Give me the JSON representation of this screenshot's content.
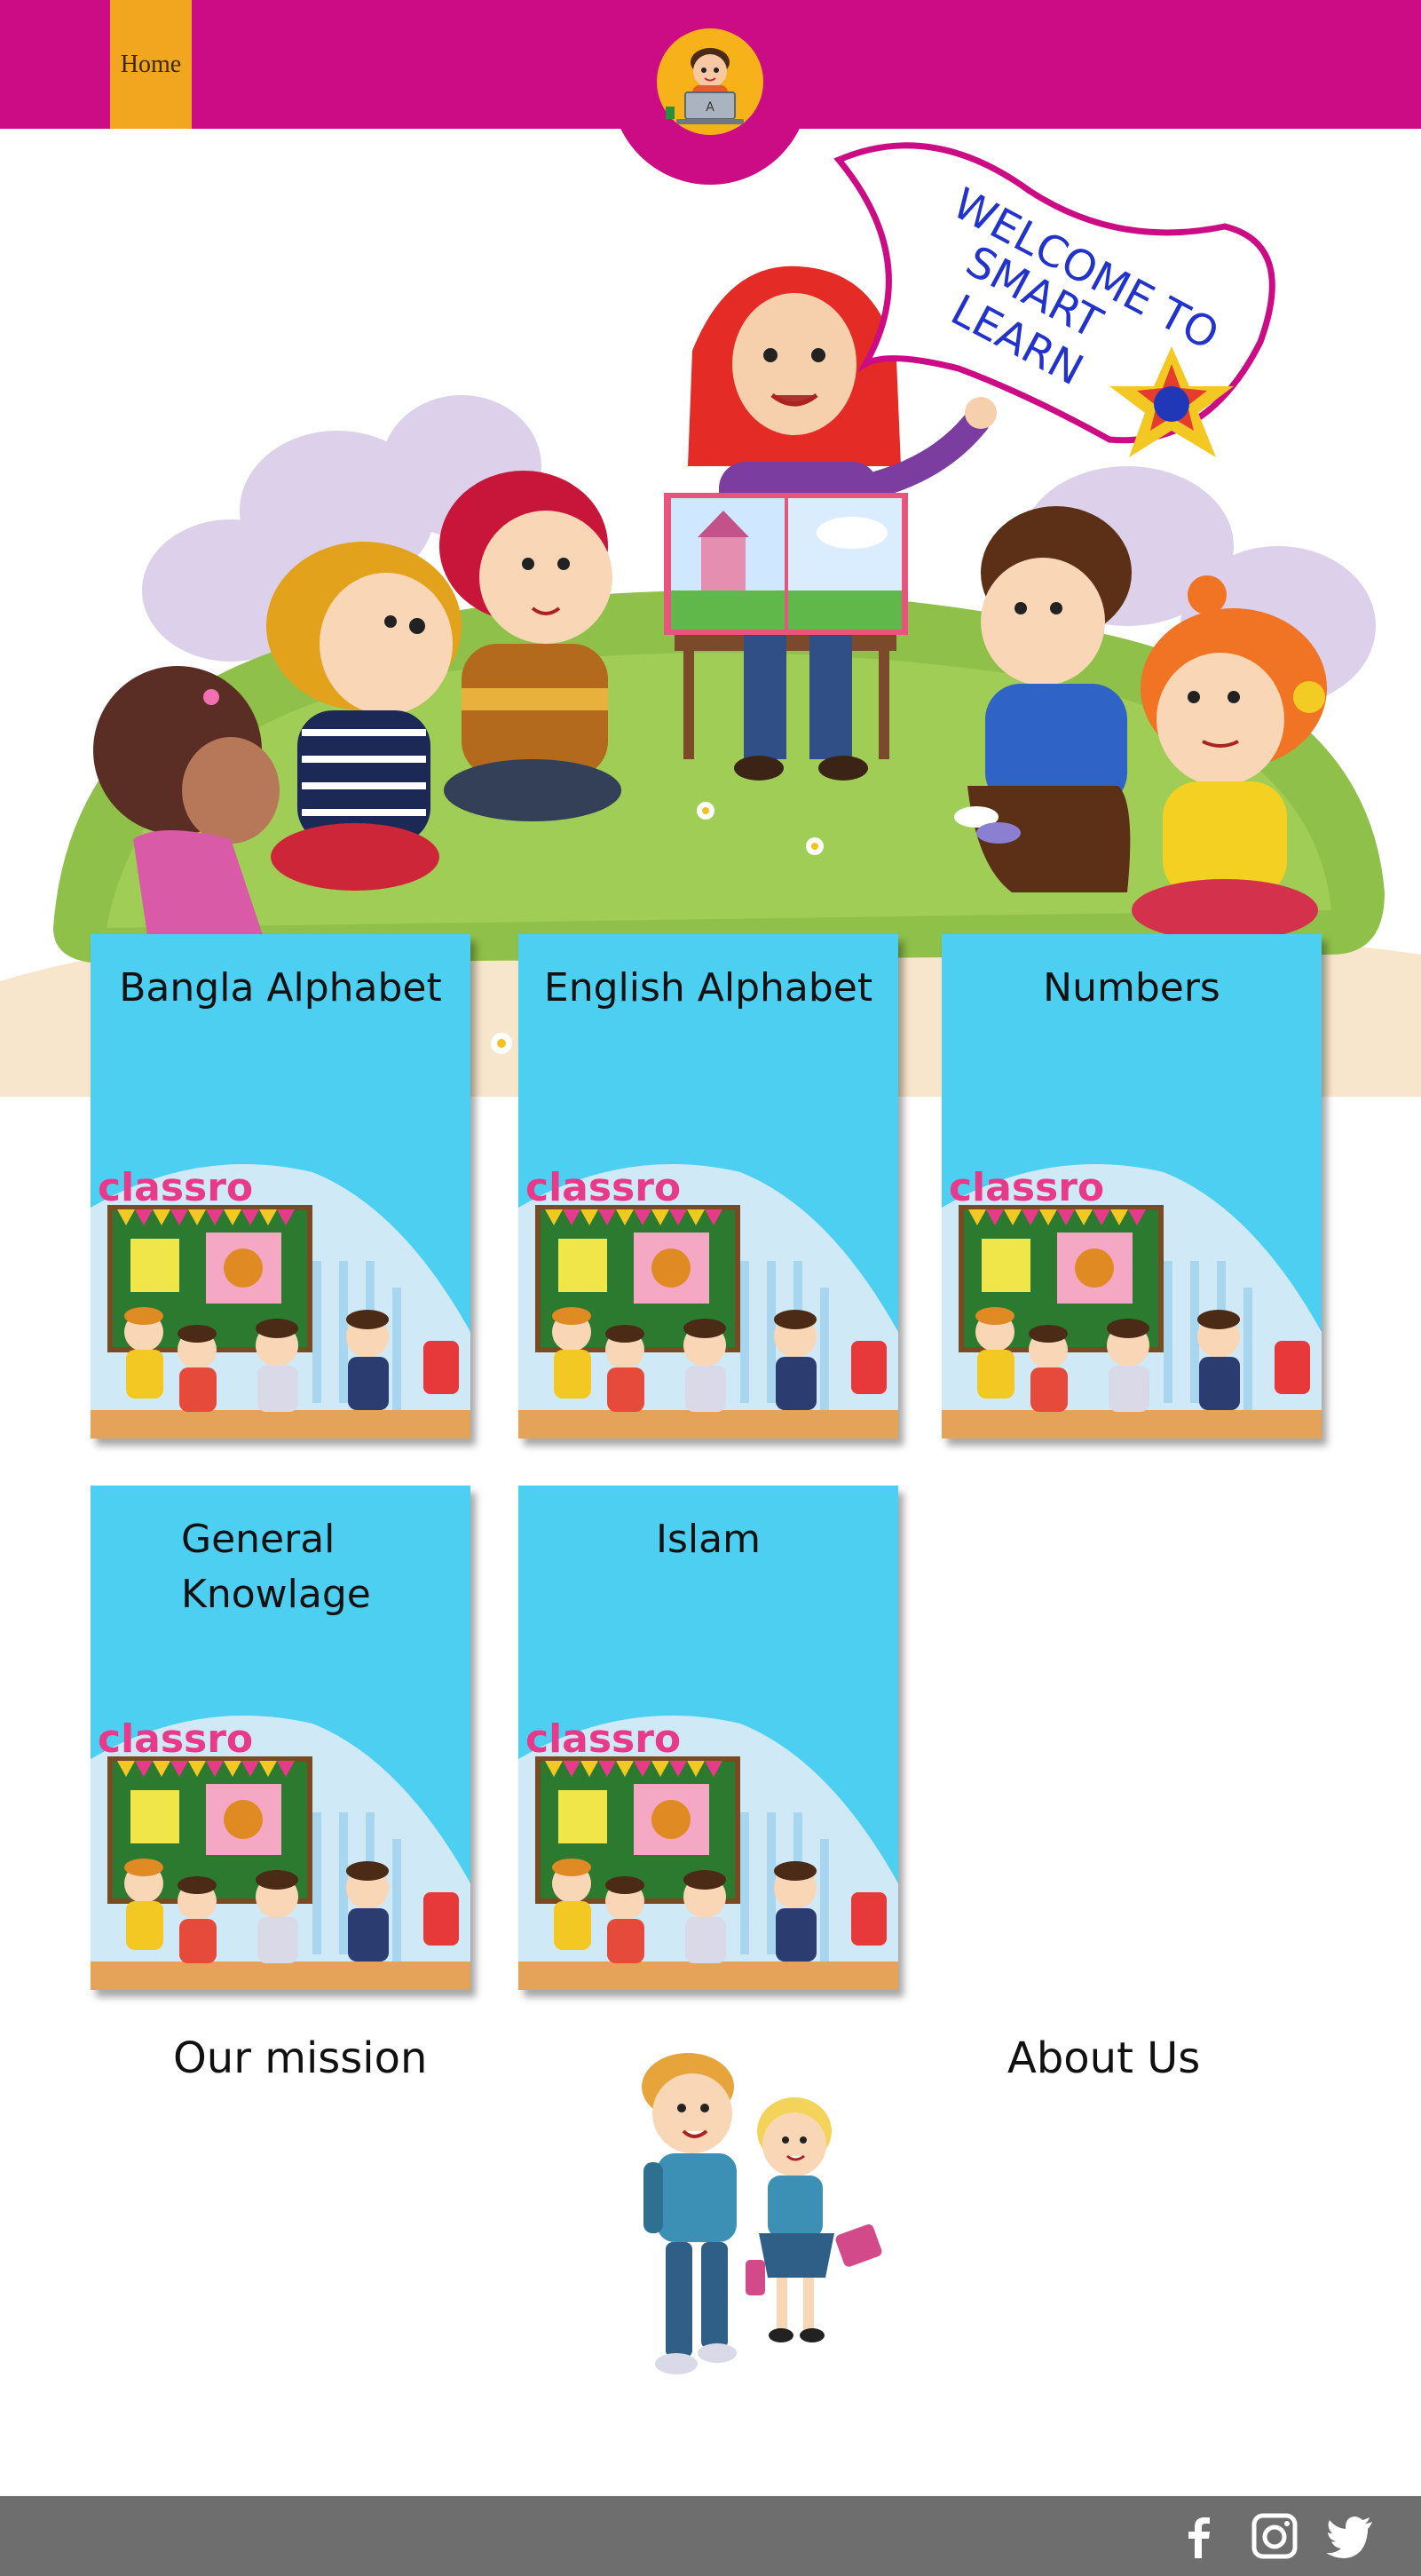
{
  "header": {
    "home_label": "Home",
    "logo_icon": "kid-with-laptop-logo-icon",
    "brand_color": "#cc0c85",
    "home_color": "#f2a51f"
  },
  "hero": {
    "banner_text": "WELCOME TO SMART LEARN"
  },
  "categories": [
    {
      "title": "Bangla Alphabet",
      "image_text": "classroom"
    },
    {
      "title": "English Alphabet",
      "image_text": "classroom"
    },
    {
      "title": "Numbers",
      "image_text": "classroom"
    },
    {
      "title": "General Knowlage",
      "image_text": "classroom"
    },
    {
      "title": "Islam",
      "image_text": "classroom"
    }
  ],
  "bottom": {
    "mission_label": "Our mission",
    "about_label": "About Us"
  },
  "footer": {
    "social": [
      "facebook-icon",
      "instagram-icon",
      "twitter-icon"
    ],
    "footer_color": "#6e6e6e"
  }
}
